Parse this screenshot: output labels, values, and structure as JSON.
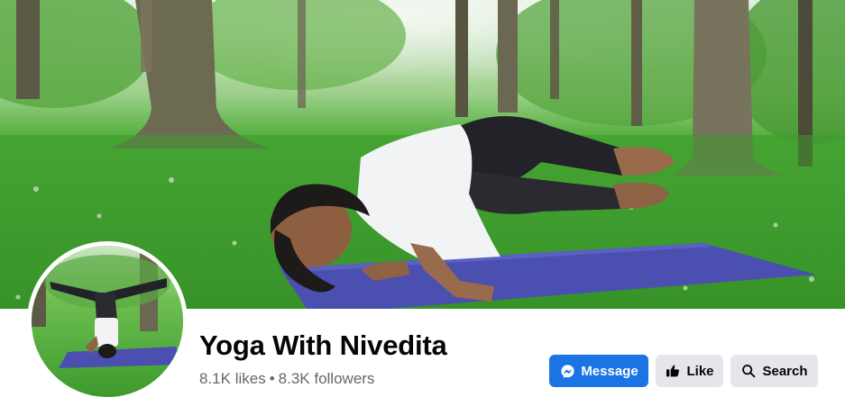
{
  "page": {
    "name": "Yoga With Nivedita",
    "likes": "8.1K likes",
    "separator": "•",
    "followers": "8.3K followers"
  },
  "cover_photo": {
    "description_icon": "yoga-crow-pose-photo"
  },
  "profile_picture": {
    "description_icon": "yoga-headstand-photo"
  },
  "actions": {
    "message_label": "Message",
    "message_icon": "messenger-icon",
    "like_label": "Like",
    "like_icon": "thumbs-up-icon",
    "search_label": "Search",
    "search_icon": "search-icon"
  },
  "colors": {
    "primary_button": "#1b74e4",
    "secondary_button": "#e4e6eb",
    "name_text": "#050505",
    "stats_text": "#65676b",
    "mat": "#4a4fb0",
    "grass": "#3f9a2e"
  }
}
